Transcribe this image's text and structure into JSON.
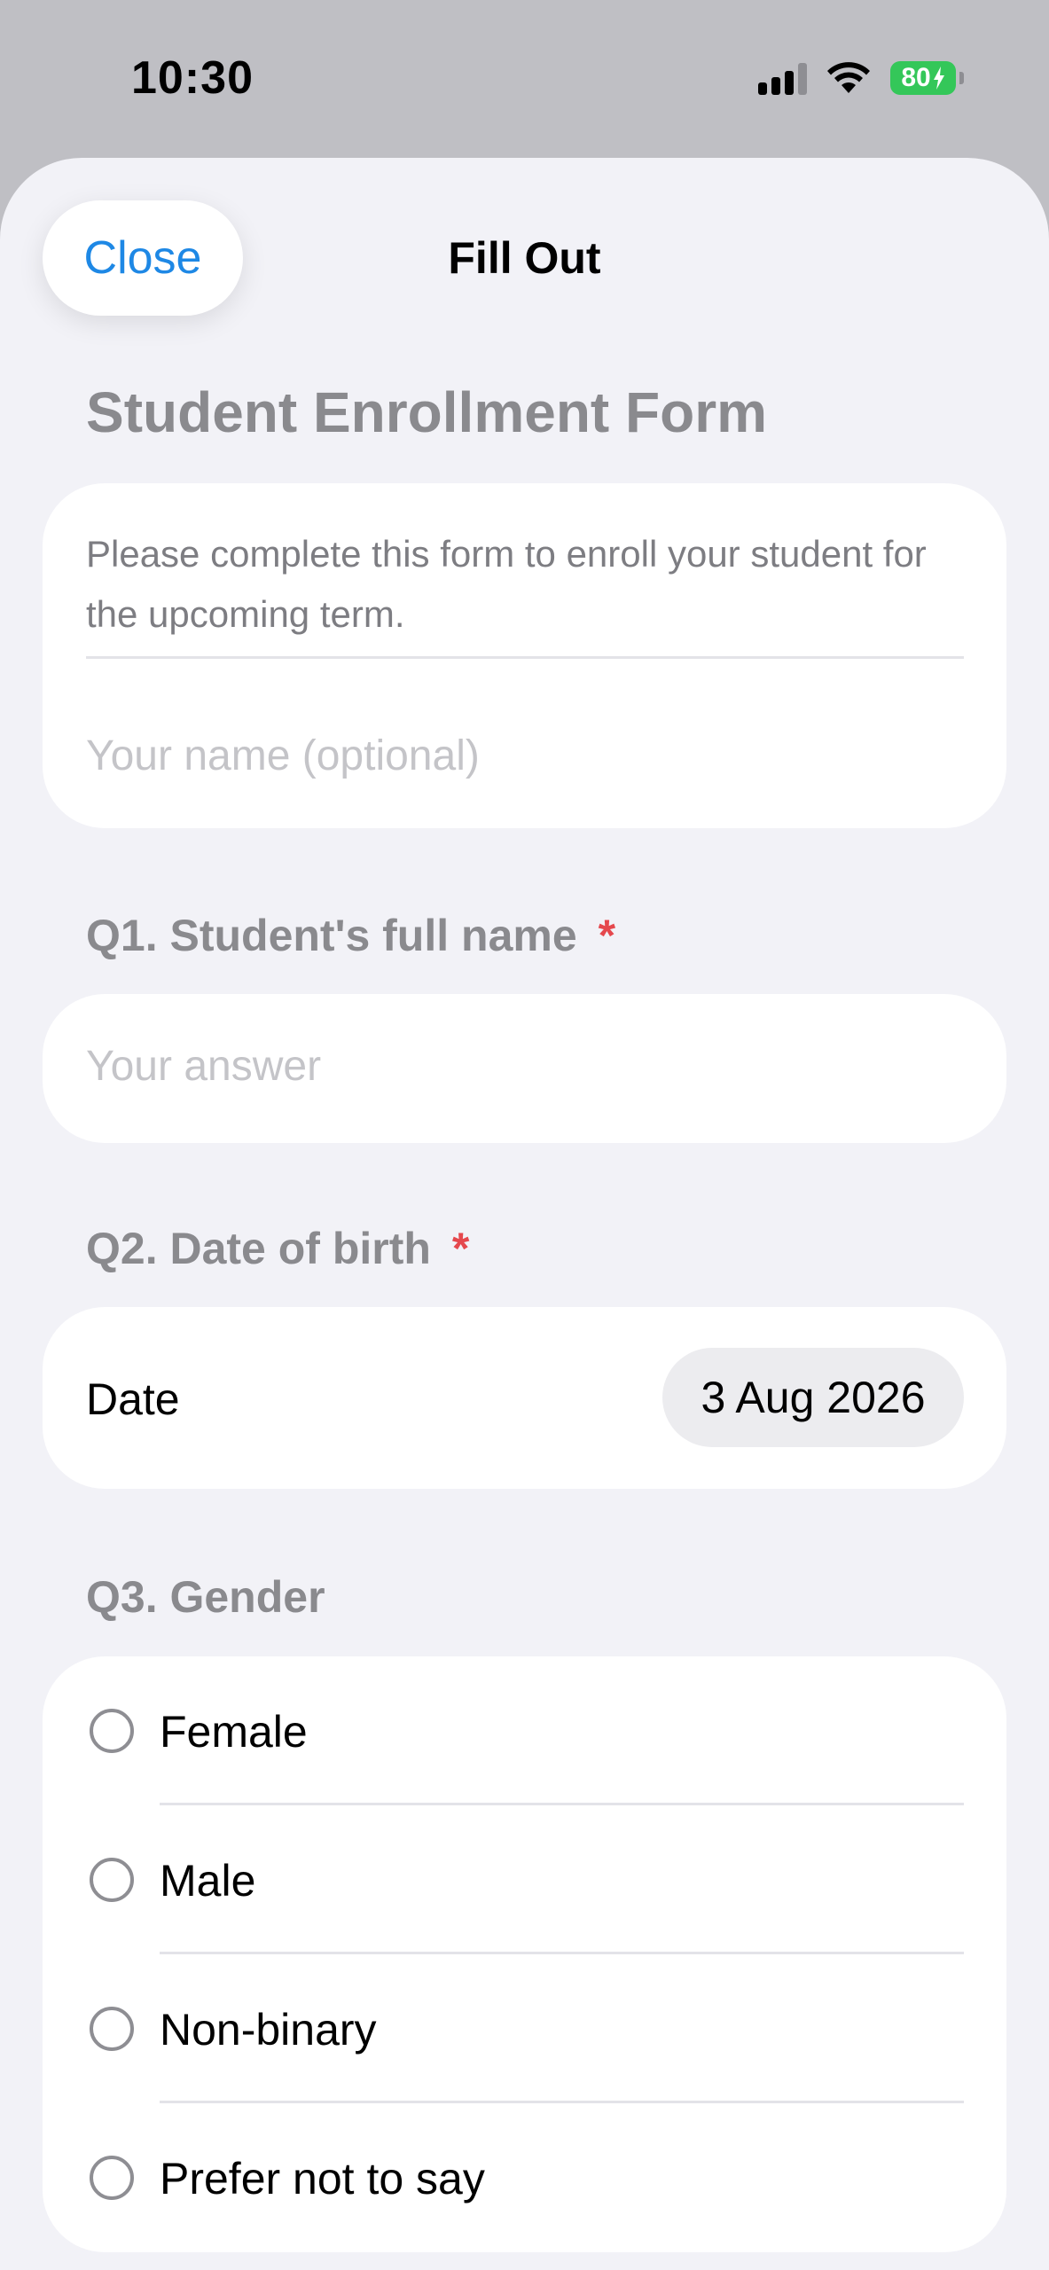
{
  "status_bar": {
    "time": "10:30",
    "battery": "80"
  },
  "nav": {
    "close_label": "Close",
    "title": "Fill Out"
  },
  "form": {
    "title": "Student Enrollment Form",
    "description": "Please complete this form to enroll your student for the upcoming term.",
    "name_placeholder": "Your name (optional)"
  },
  "questions": {
    "q1": {
      "label": "Q1. Student's full name",
      "required_mark": "*",
      "placeholder": "Your answer"
    },
    "q2": {
      "label": "Q2. Date of birth",
      "required_mark": "*",
      "field_label": "Date",
      "value": "3 Aug 2026"
    },
    "q3": {
      "label": "Q3. Gender",
      "options": [
        "Female",
        "Male",
        "Non-binary",
        "Prefer not to say"
      ]
    }
  },
  "colors": {
    "accent": "#1e88e5",
    "required": "#e5484d",
    "battery": "#34c759"
  }
}
